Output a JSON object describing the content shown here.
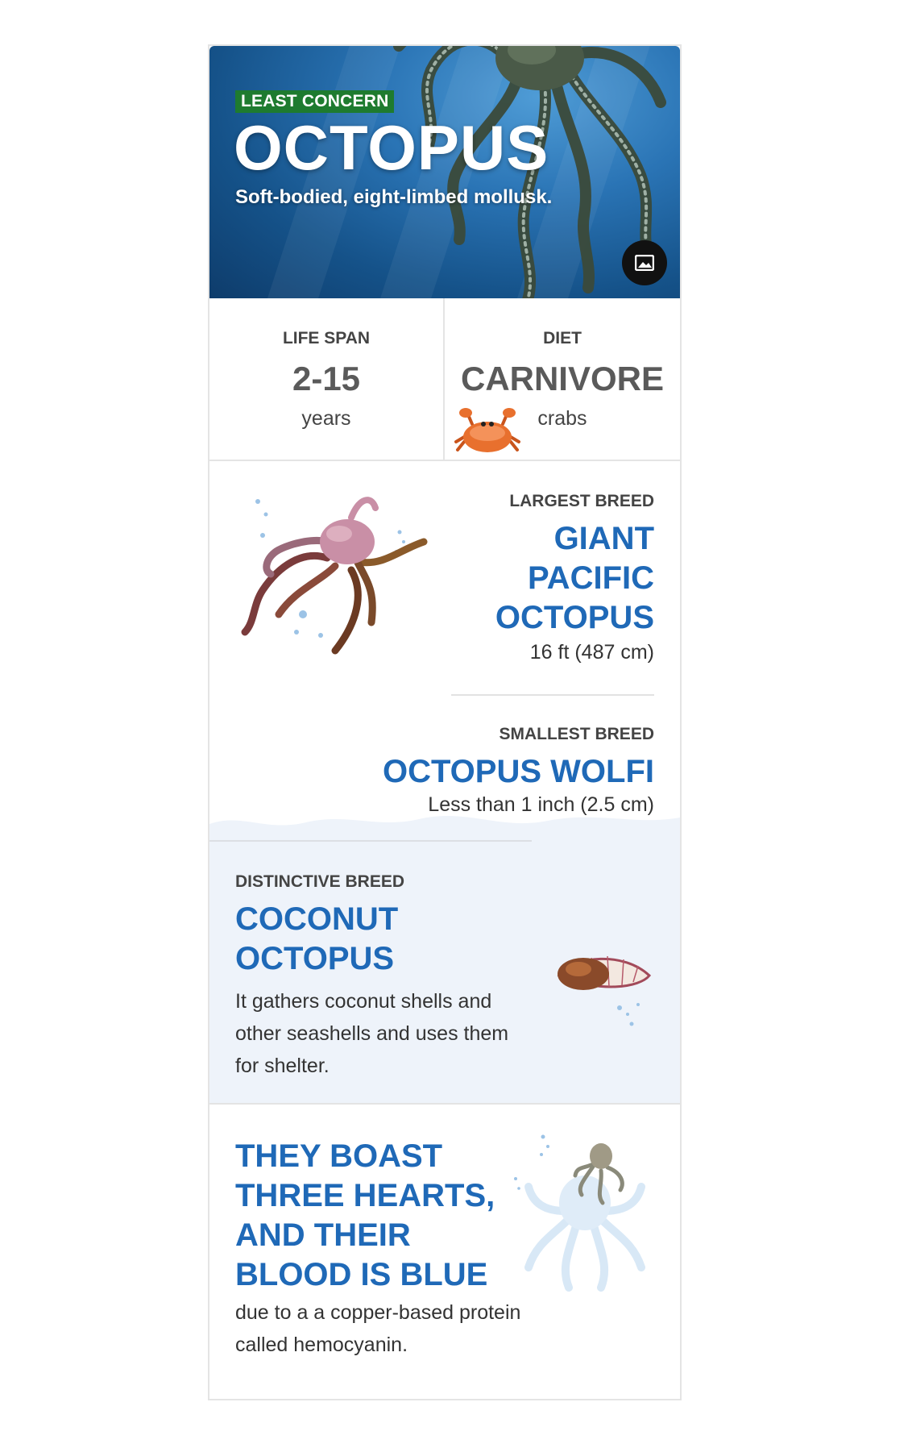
{
  "hero": {
    "status": "LEAST CONCERN",
    "title": "OCTOPUS",
    "subtitle": "Soft-bodied, eight-limbed mollusk.",
    "image_button_icon": "image-icon",
    "colors": {
      "status_badge": "#1e7b2f",
      "ocean": "#2a74b5"
    }
  },
  "stats": {
    "lifespan": {
      "label": "LIFE SPAN",
      "value": "2-15",
      "unit": "years"
    },
    "diet": {
      "label": "DIET",
      "value": "CARNIVORE",
      "unit": "crabs",
      "icon": "crab-icon"
    }
  },
  "breeds": {
    "largest": {
      "label": "LARGEST BREED",
      "name_lines": [
        "GIANT",
        "PACIFIC",
        "OCTOPUS"
      ],
      "size": "16 ft (487 cm)"
    },
    "smallest": {
      "label": "SMALLEST BREED",
      "name": "OCTOPUS WOLFI",
      "size": "Less than 1 inch (2.5 cm)"
    },
    "distinctive": {
      "label": "DISTINCTIVE BREED",
      "name_lines": [
        "COCONUT",
        "OCTOPUS"
      ],
      "description": "It gathers coconut shells and other seashells and uses them for shelter."
    }
  },
  "fact": {
    "title_lines": [
      "THEY BOAST",
      "THREE HEARTS,",
      "AND THEIR",
      "BLOOD IS BLUE"
    ],
    "description": "due to a a copper-based protein called hemocyanin."
  },
  "colors": {
    "accent_blue": "#1f69b7",
    "light_panel": "#eef3fa"
  }
}
